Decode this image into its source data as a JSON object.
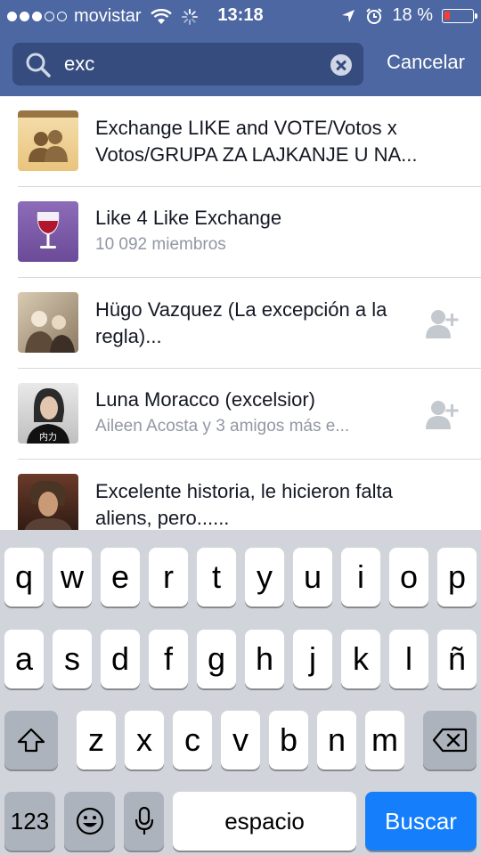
{
  "status_bar": {
    "carrier": "movistar",
    "time": "13:18",
    "battery": "18 %"
  },
  "search": {
    "query": "exc",
    "cancel_label": "Cancelar"
  },
  "results": [
    {
      "title": "Exchange LIKE and VOTE/Votos x Votos/GRUPA ZA LAJKANJE U NA...",
      "subtitle": "",
      "icon": "group-icon",
      "action": ""
    },
    {
      "title": "Like 4 Like Exchange",
      "subtitle": "10 092 miembros",
      "icon": "wine-glass-icon",
      "action": ""
    },
    {
      "title": "Hügo Vazquez (La excepción a la regla)...",
      "subtitle": "",
      "icon": "profile-photo",
      "action": "add-friend-icon"
    },
    {
      "title": "Luna Moracco (excelsior)",
      "subtitle": "Aileen Acosta y 3 amigos más e...",
      "icon": "profile-photo",
      "action": "add-friend-icon"
    },
    {
      "title": "Excelente historia, le hicieron falta aliens, pero......",
      "subtitle": "",
      "icon": "profile-photo",
      "action": ""
    }
  ],
  "keyboard": {
    "row1": [
      "q",
      "w",
      "e",
      "r",
      "t",
      "y",
      "u",
      "i",
      "o",
      "p"
    ],
    "row2": [
      "a",
      "s",
      "d",
      "f",
      "g",
      "h",
      "j",
      "k",
      "l",
      "ñ"
    ],
    "row3": [
      "z",
      "x",
      "c",
      "v",
      "b",
      "n",
      "m"
    ],
    "numbers_label": "123",
    "space_label": "espacio",
    "return_label": "Buscar"
  },
  "colors": {
    "header": "#4c67a1",
    "search_field": "#364c7f",
    "keyboard_bg": "#d1d5db",
    "return_key": "#147efb"
  }
}
